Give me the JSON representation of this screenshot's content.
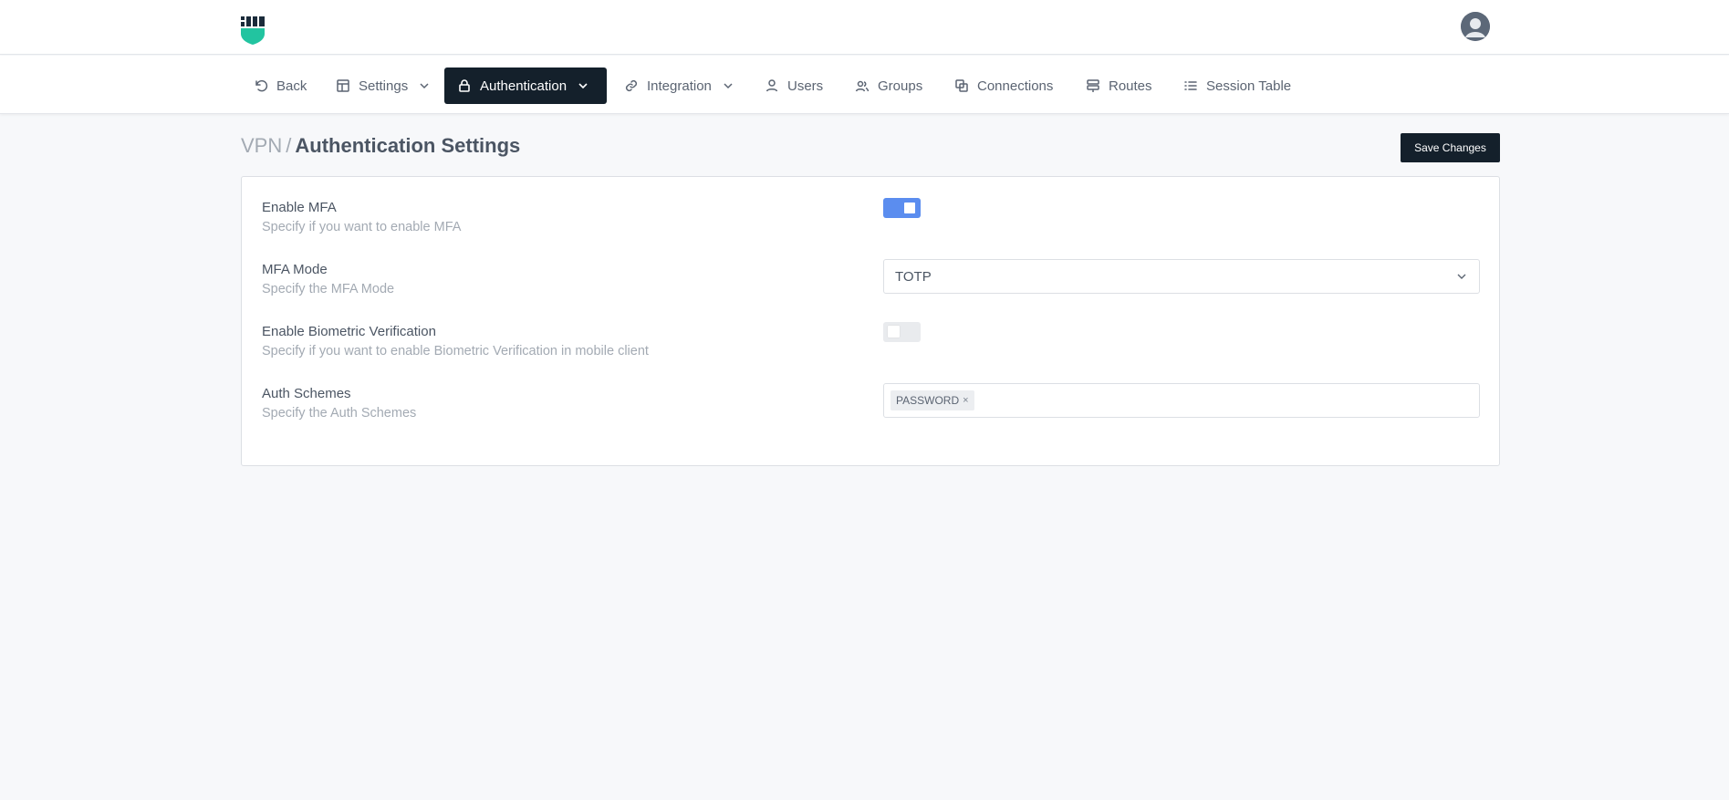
{
  "nav": {
    "back": "Back",
    "settings": "Settings",
    "authentication": "Authentication",
    "integration": "Integration",
    "users": "Users",
    "groups": "Groups",
    "connections": "Connections",
    "routes": "Routes",
    "session_table": "Session Table"
  },
  "header": {
    "breadcrumb": "VPN",
    "separator": "/",
    "title": "Authentication Settings",
    "save_label": "Save Changes"
  },
  "settings": {
    "mfa": {
      "label": "Enable MFA",
      "description": "Specify if you want to enable MFA",
      "enabled": true
    },
    "mfa_mode": {
      "label": "MFA Mode",
      "description": "Specify the MFA Mode",
      "value": "TOTP"
    },
    "biometric": {
      "label": "Enable Biometric Verification",
      "description": "Specify if you want to enable Biometric Verification in mobile client",
      "enabled": false
    },
    "auth_schemes": {
      "label": "Auth Schemes",
      "description": "Specify the Auth Schemes",
      "tags": [
        "PASSWORD"
      ],
      "remove_glyph": "×"
    }
  },
  "colors": {
    "accent": "#5b8def",
    "dark": "#14202b",
    "logo_teal": "#22c4a0",
    "logo_dark": "#1b2b3a"
  },
  "icons": {
    "back": "undo-icon",
    "settings": "layout-icon",
    "authentication": "lock-icon",
    "integration": "link-icon",
    "users": "user-icon",
    "groups": "users-icon",
    "connections": "connections-icon",
    "routes": "signpost-icon",
    "session_table": "list-icon"
  }
}
